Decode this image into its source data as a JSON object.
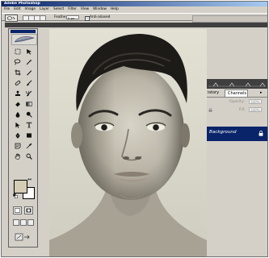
{
  "window": {
    "title": "Adobe Photoshop"
  },
  "menu": [
    "File",
    "Edit",
    "Image",
    "Layer",
    "Select",
    "Filter",
    "View",
    "Window",
    "Help"
  ],
  "options_bar": {
    "feather_label": "Feather:",
    "feather_value": "0 px",
    "anti_alias_check": "✓",
    "anti_alias_label": "Anti-aliased"
  },
  "layers_panel": {
    "tabs": [
      "istory",
      "Channels"
    ],
    "menu_icon": "▸",
    "opacity_label": "Opacity:",
    "opacity_value": "100%",
    "fill_label": "Fill:",
    "fill_value": "100%",
    "layer_name": "Background"
  },
  "toolbox": {
    "foreground_color": "#d4ccb4",
    "background_color": "#ffffff",
    "swap_icon": "↔"
  },
  "colors": {
    "titlebar": "#0a246a",
    "selection": "#0a246a",
    "dark_band": "#3f3f3f"
  },
  "icons": [
    "marquee-icon",
    "move-icon",
    "lasso-icon",
    "magic-wand-icon",
    "crop-icon",
    "slice-icon",
    "healing-brush-icon",
    "brush-icon",
    "clone-stamp-icon",
    "history-brush-icon",
    "eraser-icon",
    "gradient-icon",
    "blur-icon",
    "dodge-icon",
    "path-selection-icon",
    "type-icon",
    "pen-icon",
    "shape-icon",
    "notes-icon",
    "eyedropper-icon",
    "hand-icon",
    "zoom-icon",
    "eye-icon",
    "lock-icon"
  ]
}
